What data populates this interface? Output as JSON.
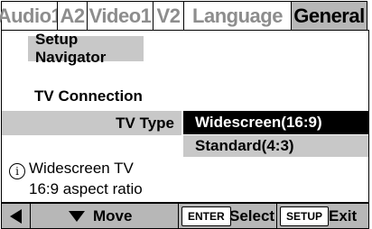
{
  "tabs": [
    {
      "label": "Audio1",
      "active": false
    },
    {
      "label": "A2",
      "active": false
    },
    {
      "label": "Video1",
      "active": false
    },
    {
      "label": "V2",
      "active": false
    },
    {
      "label": "Language",
      "active": false
    },
    {
      "label": "General",
      "active": true
    }
  ],
  "panel": {
    "navigator_label": "Setup Navigator",
    "section_heading": "TV Connection",
    "setting_label": "TV Type",
    "options": [
      {
        "label": "Widescreen(16:9)",
        "selected": true
      },
      {
        "label": "Standard(4:3)",
        "selected": false
      }
    ],
    "info": {
      "icon": "info-icon",
      "icon_glyph": "i",
      "line1": "Widescreen TV",
      "line2": "16:9 aspect ratio"
    }
  },
  "bottom_bar": {
    "left_icon": "left-arrow-icon",
    "down_icon": "down-arrow-icon",
    "move_label": "Move",
    "enter_key": "ENTER",
    "select_label": "Select",
    "setup_key": "SETUP",
    "exit_label": "Exit"
  },
  "colors": {
    "tab_inactive_text": "#8d8d8d",
    "tab_active_bg": "#b7b7b7",
    "highlight_bg": "#c8c8c8",
    "selected_bg": "#000000",
    "selected_text": "#ffffff"
  }
}
